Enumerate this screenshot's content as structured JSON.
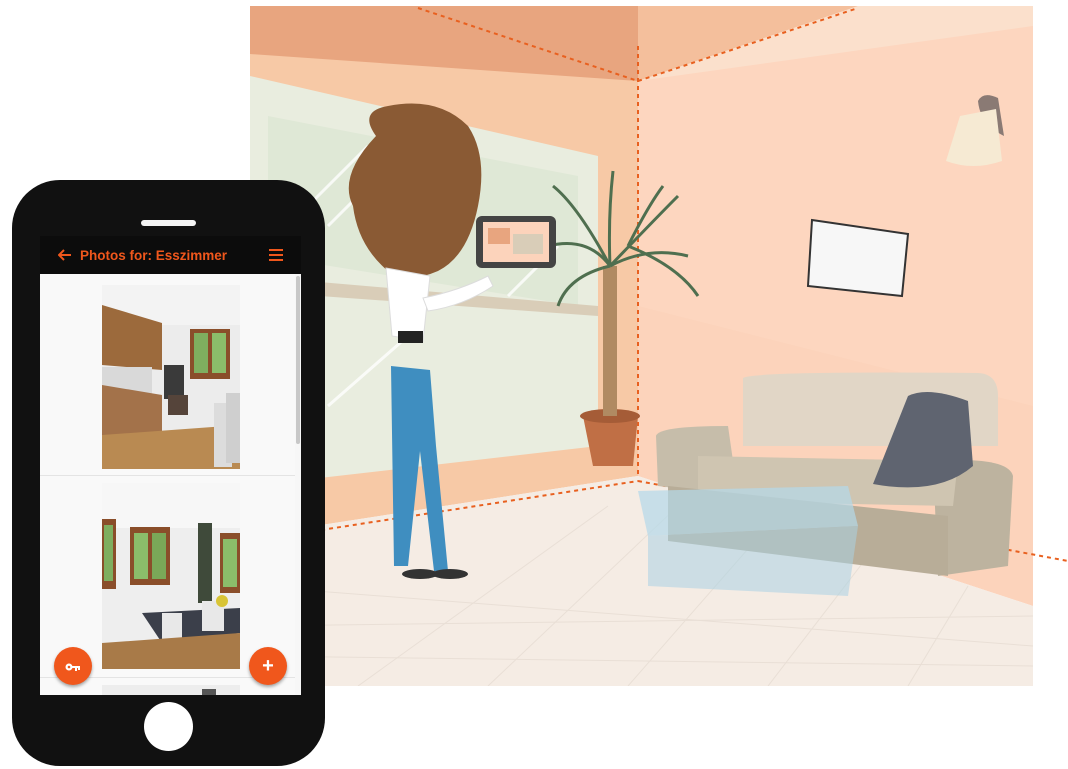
{
  "app": {
    "title": "Photos for: Esszimmer",
    "icons": {
      "back": "arrow-left-icon",
      "menu": "hamburger-menu-icon",
      "key_fab": "key-icon",
      "add_fab": "plus-icon"
    },
    "add_label": "+",
    "photos": [
      {
        "subject": "kitchen-photo"
      },
      {
        "subject": "dining-room-photo"
      },
      {
        "subject": "room-photo-partial"
      }
    ]
  },
  "colors": {
    "accent": "#f0571c",
    "appbar": "#0c0c0c",
    "phone_frame": "#111111",
    "wall": "#fcd3b8",
    "floor": "#f6eee6"
  }
}
